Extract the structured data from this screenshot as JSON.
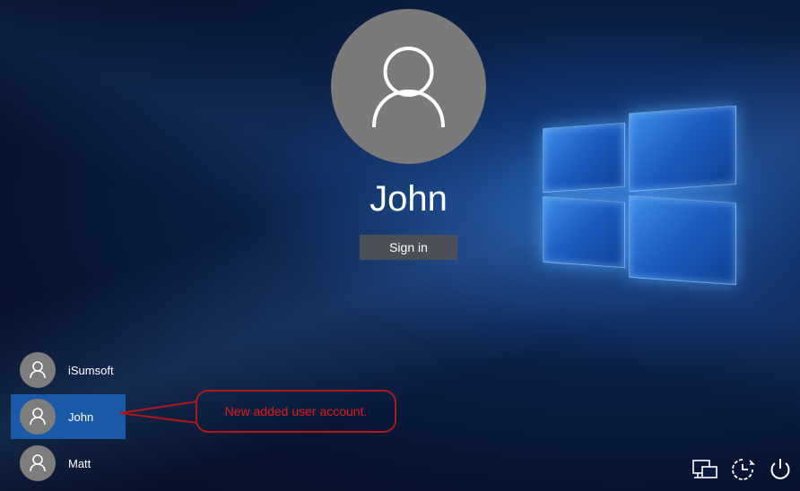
{
  "main_user": {
    "name": "John",
    "signin_label": "Sign in",
    "avatar_icon": "user-avatar-icon"
  },
  "user_list": [
    {
      "name": "iSumsoft",
      "selected": false
    },
    {
      "name": "John",
      "selected": true
    },
    {
      "name": "Matt",
      "selected": false
    }
  ],
  "annotation": {
    "text": "New added user account.",
    "color": "#e01a1a"
  },
  "system_icons": [
    "network-icon",
    "ease-of-access-icon",
    "power-icon"
  ],
  "colors": {
    "selected_bg": "#1a5aa8",
    "button_bg": "#4b4f57",
    "avatar_bg": "#7a7a7a"
  }
}
